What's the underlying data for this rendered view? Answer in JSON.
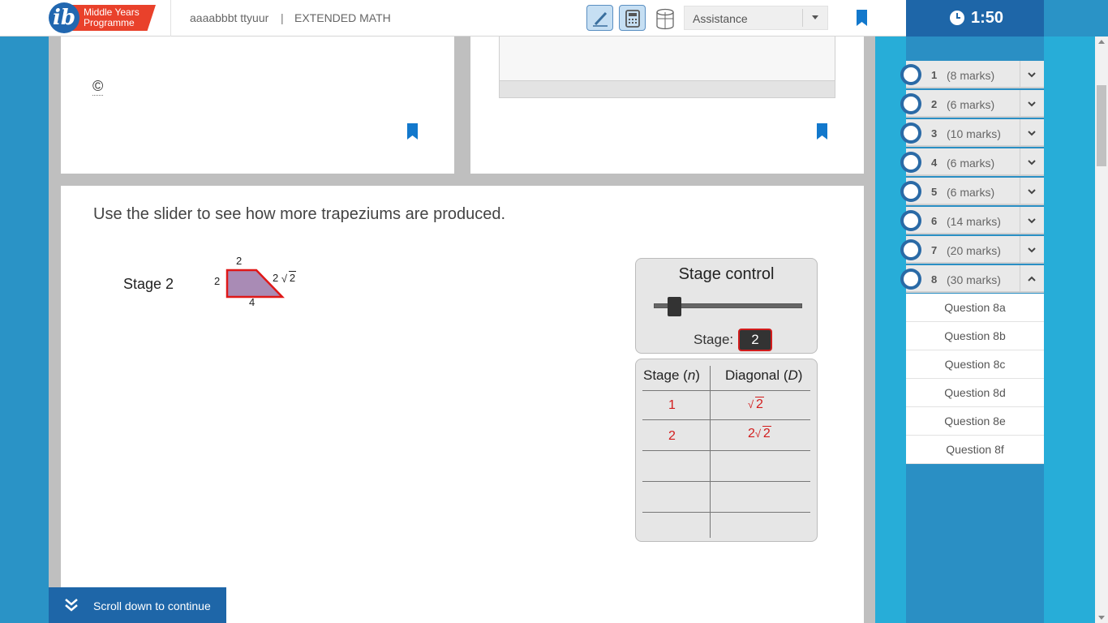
{
  "header": {
    "logo_line1": "Middle Years",
    "logo_line2": "Programme",
    "candidate": "aaaabbbt ttyuur",
    "separator": "|",
    "subject": "EXTENDED MATH",
    "assistance_label": "Assistance"
  },
  "timer": {
    "time": "1:50"
  },
  "content": {
    "copyright_symbol": "©",
    "instruction": "Use the slider to see how more trapeziums are produced.",
    "stage_label": "Stage 2",
    "trapezium": {
      "top": "2",
      "left": "2",
      "bottom": "4",
      "slant_coef": "2",
      "slant_rad": "2"
    }
  },
  "stage_control": {
    "title": "Stage control",
    "stage_label": "Stage:",
    "stage_value": "2",
    "slider_fraction": 0.1
  },
  "table": {
    "header_n_prefix": "Stage (",
    "header_n_var": "n",
    "header_n_suffix": ")",
    "header_d_prefix": "Diagonal (",
    "header_d_var": "D",
    "header_d_suffix": ")",
    "rows": [
      {
        "n": "1",
        "d_coef": "",
        "d_rad": "2"
      },
      {
        "n": "2",
        "d_coef": "2",
        "d_rad": "2"
      }
    ]
  },
  "questions": [
    {
      "num": "1",
      "marks": "(8 marks)"
    },
    {
      "num": "2",
      "marks": "(6 marks)"
    },
    {
      "num": "3",
      "marks": "(10 marks)"
    },
    {
      "num": "4",
      "marks": "(6 marks)"
    },
    {
      "num": "5",
      "marks": "(6 marks)"
    },
    {
      "num": "6",
      "marks": "(14 marks)"
    },
    {
      "num": "7",
      "marks": "(20 marks)"
    },
    {
      "num": "8",
      "marks": "(30 marks)"
    }
  ],
  "subquestions": [
    "Question 8a",
    "Question 8b",
    "Question 8c",
    "Question 8d",
    "Question 8e",
    "Question 8f"
  ],
  "footer": {
    "scroll_text": "Scroll down to continue"
  },
  "colors": {
    "accent_blue": "#1e66a8",
    "panel_blue": "#27add8",
    "answer_red": "#d21c1c",
    "brand_red": "#e9412b"
  }
}
